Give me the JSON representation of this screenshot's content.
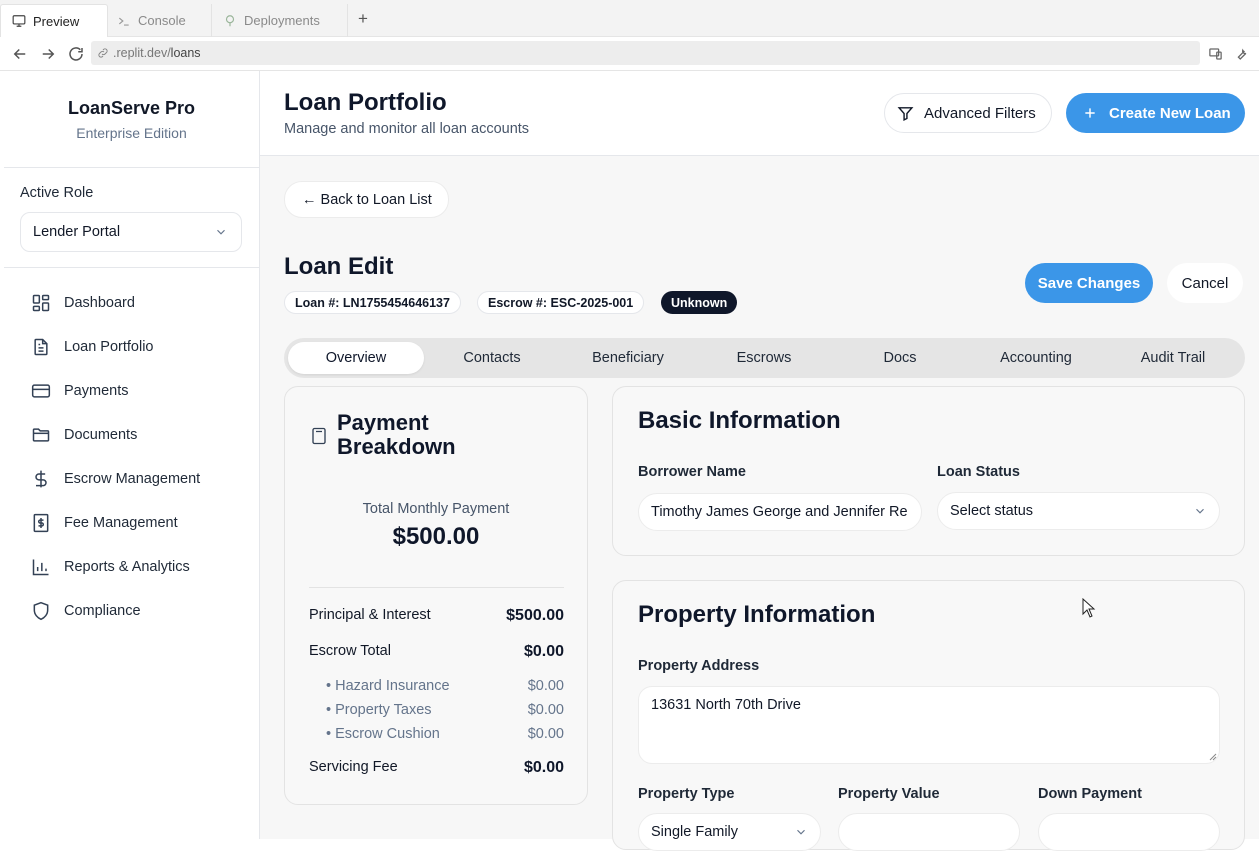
{
  "browser": {
    "tabs": [
      {
        "label": "Preview",
        "icon": "monitor-icon"
      },
      {
        "label": "Console",
        "icon": "terminal-icon"
      },
      {
        "label": "Deployments",
        "icon": "deploy-icon"
      }
    ],
    "new_tab": "+",
    "url_host": ".replit.dev/",
    "url_path": "loans"
  },
  "sidebar": {
    "app_name": "LoanServe Pro",
    "edition": "Enterprise Edition",
    "role_label": "Active Role",
    "role_value": "Lender Portal",
    "items": [
      {
        "label": "Dashboard",
        "icon": "dashboard-icon"
      },
      {
        "label": "Loan Portfolio",
        "icon": "file-text-icon"
      },
      {
        "label": "Payments",
        "icon": "credit-card-icon"
      },
      {
        "label": "Documents",
        "icon": "folder-icon"
      },
      {
        "label": "Escrow Management",
        "icon": "dollar-icon"
      },
      {
        "label": "Fee Management",
        "icon": "receipt-dollar-icon"
      },
      {
        "label": "Reports & Analytics",
        "icon": "bar-chart-icon"
      },
      {
        "label": "Compliance",
        "icon": "shield-icon"
      }
    ]
  },
  "header": {
    "title": "Loan Portfolio",
    "subtitle": "Manage and monitor all loan accounts",
    "advanced_filters": "Advanced Filters",
    "create_new_loan": "Create New Loan"
  },
  "edit": {
    "back": "← Back to Loan List",
    "title": "Loan Edit",
    "loan_number": "Loan #: LN1755454646137",
    "escrow_number": "Escrow #: ESC-2025-001",
    "status_badge": "Unknown",
    "save": "Save Changes",
    "cancel": "Cancel",
    "tabs": [
      "Overview",
      "Contacts",
      "Beneficiary",
      "Escrows",
      "Docs",
      "Accounting",
      "Audit Trail"
    ],
    "active_tab": "Overview"
  },
  "payment": {
    "title": "Payment Breakdown",
    "total_label": "Total Monthly Payment",
    "total_value": "$500.00",
    "rows": [
      {
        "label": "Principal & Interest",
        "value": "$500.00"
      },
      {
        "label": "Escrow Total",
        "value": "$0.00"
      }
    ],
    "escrow_items": [
      {
        "label": "• Hazard Insurance",
        "value": "$0.00"
      },
      {
        "label": "• Property Taxes",
        "value": "$0.00"
      },
      {
        "label": "• Escrow Cushion",
        "value": "$0.00"
      }
    ],
    "servicing": {
      "label": "Servicing Fee",
      "value": "$0.00"
    }
  },
  "basic": {
    "title": "Basic Information",
    "borrower_label": "Borrower Name",
    "borrower_value": "Timothy James George and Jennifer Re",
    "status_label": "Loan Status",
    "status_placeholder": "Select status"
  },
  "property": {
    "title": "Property Information",
    "address_label": "Property Address",
    "address_value": "13631 North 70th Drive",
    "type_label": "Property Type",
    "type_value": "Single Family",
    "value_label": "Property Value",
    "value_value": "",
    "down_label": "Down Payment",
    "down_value": ""
  },
  "colors": {
    "accent": "#3b96e8",
    "dark_badge": "#0f172a",
    "content_bg": "#f7f7f7"
  }
}
